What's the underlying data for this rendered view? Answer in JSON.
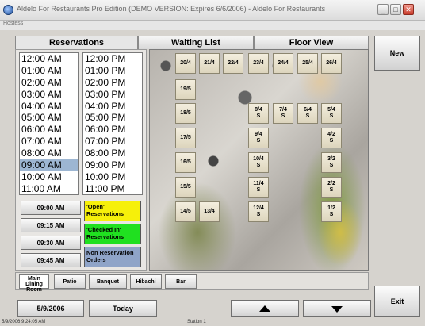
{
  "window": {
    "title": "Aldelo For Restaurants Pro Edition (DEMO VERSION: Expires 6/6/2006) - Aldelo For Restaurants",
    "menu": "Hostess",
    "controls": {
      "minimize": "_",
      "maximize": "□",
      "close": "✕"
    }
  },
  "tabs": [
    {
      "label": "Reservations"
    },
    {
      "label": "Waiting List"
    },
    {
      "label": "Floor View"
    }
  ],
  "times": {
    "am": [
      "12:00 AM",
      "01:00 AM",
      "02:00 AM",
      "03:00 AM",
      "04:00 AM",
      "05:00 AM",
      "06:00 AM",
      "07:00 AM",
      "08:00 AM",
      "09:00 AM",
      "10:00 AM",
      "11:00 AM"
    ],
    "pm": [
      "12:00 PM",
      "01:00 PM",
      "02:00 PM",
      "03:00 PM",
      "04:00 PM",
      "05:00 PM",
      "06:00 PM",
      "07:00 PM",
      "08:00 PM",
      "09:00 PM",
      "10:00 PM",
      "11:00 PM"
    ],
    "selected": "09:00 AM"
  },
  "quick_times": [
    "09:00 AM",
    "09:15 AM",
    "09:30 AM",
    "09:45 AM"
  ],
  "legend": [
    {
      "label": "'Open' Reservations",
      "color": "#f6f00a"
    },
    {
      "label": "'Checked In' Reservations",
      "color": "#20e020"
    },
    {
      "label": "Non Reservation Orders",
      "color": "#8fa4c8"
    }
  ],
  "tables": {
    "top_row": [
      "20/4",
      "21/4",
      "22/4",
      "23/4",
      "24/4",
      "25/4",
      "26/4"
    ],
    "left_col": [
      "19/5",
      "18/5",
      "17/5",
      "16/5",
      "15/5",
      "14/5"
    ],
    "t13": "13/4",
    "inner_a": [
      "8/4 S",
      "9/4 S",
      "10/4 S",
      "11/4 S",
      "12/4 S"
    ],
    "inner_b": [
      "7/4 S"
    ],
    "inner_c": [
      "6/4 S"
    ],
    "right_col": [
      "5/4 S",
      "4/2 S",
      "3/2 S",
      "2/2 S",
      "1/2 S"
    ]
  },
  "rooms": [
    "Main Dining Room",
    "Patio",
    "Banquet",
    "Hibachi",
    "Bar"
  ],
  "buttons": {
    "new": "New",
    "exit": "Exit",
    "date": "5/9/2006",
    "today": "Today"
  },
  "status": {
    "datetime": "5/9/2006 9:24:05 AM",
    "station": "Station 1"
  }
}
